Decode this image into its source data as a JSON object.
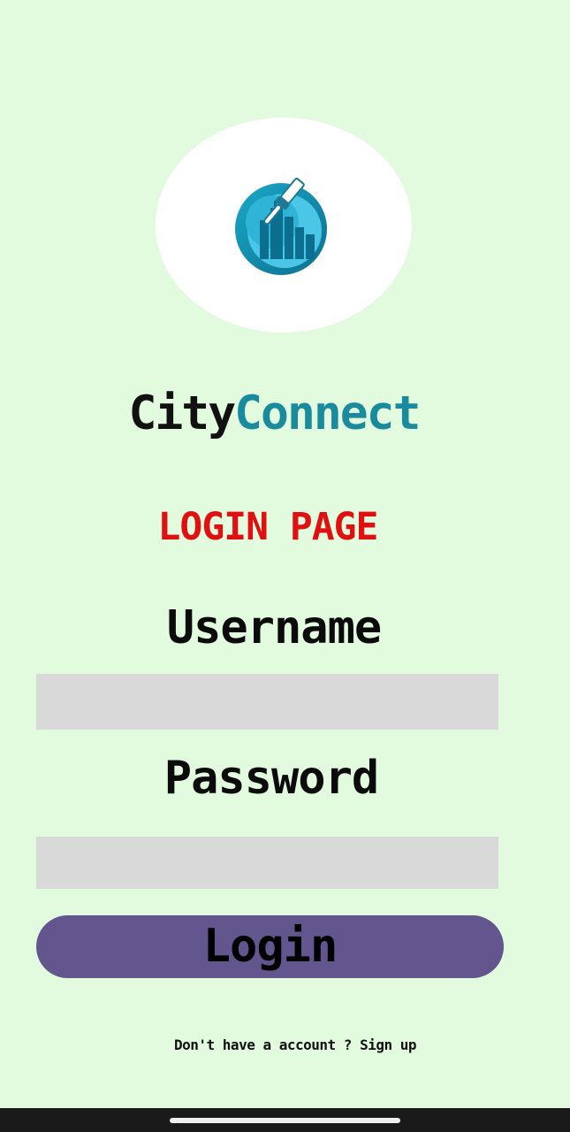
{
  "app": {
    "brand_part1": "City",
    "brand_part2": "Connect",
    "logo_icon": "city-paintbrush-logo-icon"
  },
  "page": {
    "heading": "LOGIN PAGE"
  },
  "form": {
    "username_label": "Username",
    "username_value": "",
    "password_label": "Password",
    "password_value": "",
    "login_button_label": "Login"
  },
  "footer": {
    "prompt_text": "Don't have a account ?",
    "signup_link_label": "Sign up"
  },
  "colors": {
    "background": "#e2fbdf",
    "brand_dark": "#111111",
    "brand_accent": "#1a8b9c",
    "heading_red": "#e01010",
    "input_bg": "#d9d9d9",
    "button_bg": "#63568f"
  }
}
